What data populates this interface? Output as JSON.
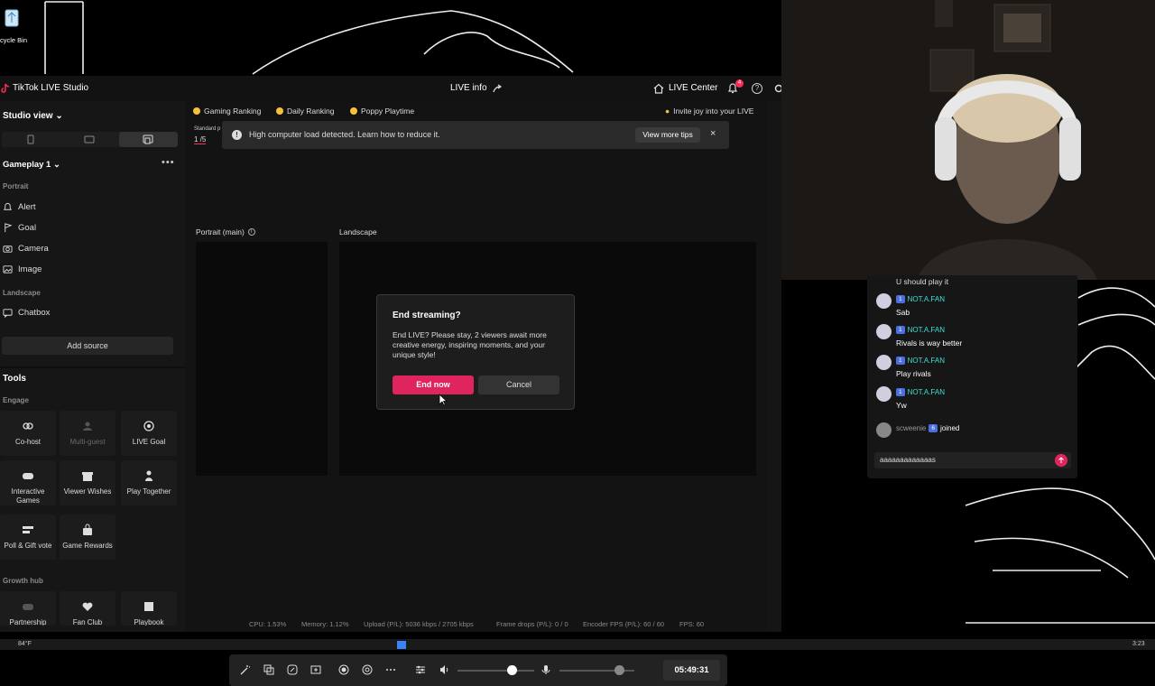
{
  "desktop": {
    "recycle_bin_label": "cycle Bin"
  },
  "titlebar": {
    "app_name": "TikTok LIVE Studio",
    "live_info": "LIVE info",
    "live_center": "LIVE Center",
    "notification_count": "4",
    "help": "?"
  },
  "left_panel": {
    "view_label": "Studio view",
    "scene_name": "Gameplay 1",
    "more": "•••",
    "portrait_section": "Portrait",
    "portrait_items": [
      "Alert",
      "Goal",
      "Camera",
      "Image"
    ],
    "landscape_section": "Landscape",
    "landscape_items": [
      "Chatbox"
    ],
    "add_source": "Add source",
    "tools_title": "Tools",
    "engage_label": "Engage",
    "tools": [
      {
        "label": "Co-host",
        "icon": "link-icon",
        "enabled": true
      },
      {
        "label": "Multi-guest",
        "icon": "users-icon",
        "enabled": false
      },
      {
        "label": "LIVE Goal",
        "icon": "target-icon",
        "enabled": true
      },
      {
        "label": "Interactive Games",
        "icon": "gamepad-icon",
        "enabled": true
      },
      {
        "label": "Viewer Wishes",
        "icon": "gift-icon",
        "enabled": true
      },
      {
        "label": "Play Together",
        "icon": "person-icon",
        "enabled": true
      },
      {
        "label": "Poll & Gift vote",
        "icon": "poll-icon",
        "enabled": true
      },
      {
        "label": "Game Rewards",
        "icon": "bag-icon",
        "enabled": true
      }
    ],
    "growth_hub_label": "Growth hub",
    "growth_tools": [
      "Partnership",
      "Fan Club",
      "Playbook"
    ]
  },
  "rankings": [
    "Gaming Ranking",
    "Daily Ranking",
    "Poppy Playtime"
  ],
  "invite": "Invite joy into your LIVE",
  "standard": "Standard p",
  "page_indicator": "1 /5",
  "banner": {
    "text": "High computer load detected. Learn how to reduce it.",
    "tips_button": "View more tips",
    "close": "×"
  },
  "preview": {
    "portrait_label": "Portrait (main)",
    "landscape_label": "Landscape"
  },
  "dialog": {
    "title": "End streaming?",
    "body": "End LIVE? Please stay, 2 viewers await more creative energy, inspiring moments, and your unique style!",
    "end_button": "End now",
    "cancel_button": "Cancel"
  },
  "toolbar": {
    "timer": "05:49:31",
    "speaker_volume": 0.7,
    "mic_volume": 0.8
  },
  "stats": {
    "cpu": "CPU: 1.53%",
    "memory": "Memory: 1.12%",
    "upload": "Upload (P/L): 5036 kbps / 2705 kbps",
    "frame_drops": "Frame drops (P/L): 0 / 0",
    "encoder": "Encoder FPS (P/L): 60 / 60",
    "fps": "FPS: 60"
  },
  "chat": {
    "top_message": "U should play it",
    "messages": [
      {
        "user": "NOT.A.FAN",
        "level": "1",
        "text": "Sab"
      },
      {
        "user": "NOT.A.FAN",
        "level": "1",
        "text": "Rivals is way better"
      },
      {
        "user": "NOT.A.FAN",
        "level": "1",
        "text": "Play rivals"
      },
      {
        "user": "NOT.A.FAN",
        "level": "1",
        "text": "Yw"
      }
    ],
    "join_user": "scweenie",
    "join_level": "6",
    "join_text": "joined",
    "input_value": "aaaaaaaaaaaaas"
  },
  "taskbar": {
    "temp": "84°F",
    "clock": "3:23"
  },
  "colors": {
    "accent": "#e0245e",
    "chat_user": "#3ee0d2",
    "level_badge": "#4c6fe0"
  }
}
